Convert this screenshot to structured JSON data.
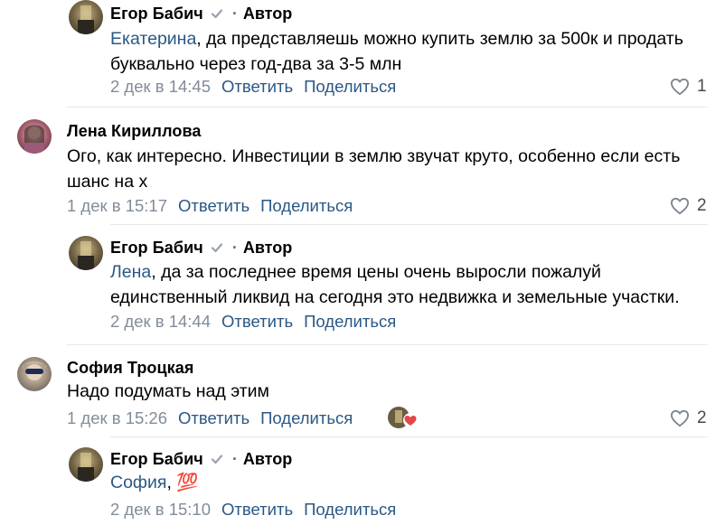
{
  "comments": [
    {
      "author": "Егор Бабич",
      "author_badge": "Автор",
      "mention": "Екатерина",
      "text_line1": ", да представляешь можно купить землю за 500к и продать",
      "text_line2": "буквально через год-два за 3-5 млн",
      "date": "2 дек в 14:45",
      "reply": "Ответить",
      "share": "Поделиться",
      "likes": "1"
    },
    {
      "author": "Лена Кириллова",
      "text_line1": "Ого, как интересно. Инвестиции в землю звучат круто, особенно если есть",
      "text_line2": "шанс на х",
      "date": "1 дек в 15:17",
      "reply": "Ответить",
      "share": "Поделиться",
      "likes": "2"
    },
    {
      "author": "Егор Бабич",
      "author_badge": "Автор",
      "mention": "Лена",
      "text_line1": ", да за последнее время цены очень выросли пожалуй",
      "text_line2": "единственный ликвид на сегодня это недвижка и земельные участки.",
      "date": "2 дек в 14:44",
      "reply": "Ответить",
      "share": "Поделиться"
    },
    {
      "author": "София Троцкая",
      "text_line1": "Надо подумать над этим",
      "date": "1 дек в 15:26",
      "reply": "Ответить",
      "share": "Поделиться",
      "likes": "2"
    },
    {
      "author": "Егор Бабич",
      "author_badge": "Автор",
      "mention": "София",
      "text_after": ", 💯",
      "date": "2 дек в 15:10",
      "reply": "Ответить",
      "share": "Поделиться"
    }
  ],
  "separator": "·",
  "colors": {
    "link": "#2a5885",
    "meta": "#818c99",
    "divider": "#e6e8eb",
    "reaction_heart": "#e64646"
  },
  "icons": [
    "verified-check-icon",
    "heart-outline-icon",
    "heart-filled-icon"
  ]
}
